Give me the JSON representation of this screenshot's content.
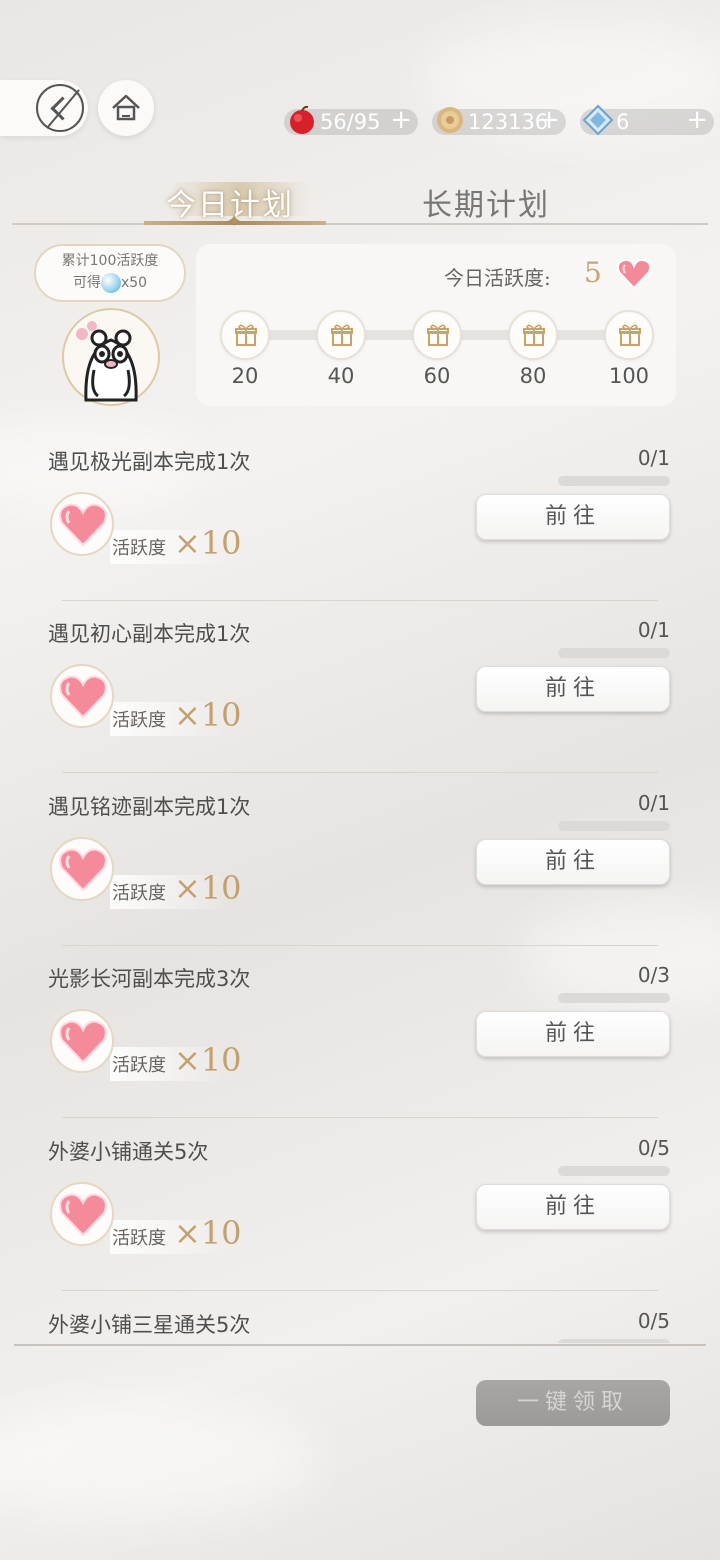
{
  "topbar": {
    "resources": [
      {
        "icon": "apple-stamina-icon",
        "value": "56/95",
        "plus": "+"
      },
      {
        "icon": "gold-coin-icon",
        "value": "123136",
        "plus": "+"
      },
      {
        "icon": "blue-diamond-icon",
        "value": "6",
        "plus": "+"
      }
    ]
  },
  "tabs": [
    {
      "label": "今日计划",
      "active": true
    },
    {
      "label": "长期计划",
      "active": false
    }
  ],
  "bonus": {
    "line1": "累计100活跃度",
    "line2_prefix": "可得",
    "line2_suffix": "x50"
  },
  "activity": {
    "label": "今日活跃度:",
    "value": "5",
    "milestones": [
      "20",
      "40",
      "60",
      "80",
      "100"
    ]
  },
  "tasks": [
    {
      "title": "遇见极光副本完成1次",
      "progress": "0/1",
      "reward_label": "活跃度",
      "reward_times": "×10",
      "button": "前往"
    },
    {
      "title": "遇见初心副本完成1次",
      "progress": "0/1",
      "reward_label": "活跃度",
      "reward_times": "×10",
      "button": "前往"
    },
    {
      "title": "遇见铭迹副本完成1次",
      "progress": "0/1",
      "reward_label": "活跃度",
      "reward_times": "×10",
      "button": "前往"
    },
    {
      "title": "光影长河副本完成3次",
      "progress": "0/3",
      "reward_label": "活跃度",
      "reward_times": "×10",
      "button": "前往"
    },
    {
      "title": "外婆小铺通关5次",
      "progress": "0/5",
      "reward_label": "活跃度",
      "reward_times": "×10",
      "button": "前往"
    },
    {
      "title": "外婆小铺三星通关5次",
      "progress": "0/5"
    }
  ],
  "claim_all": "一键领取",
  "colors": {
    "accent_gold": "#c4a070",
    "button_disabled": "#a3a19f",
    "heart_pink": "#f07a8a"
  }
}
